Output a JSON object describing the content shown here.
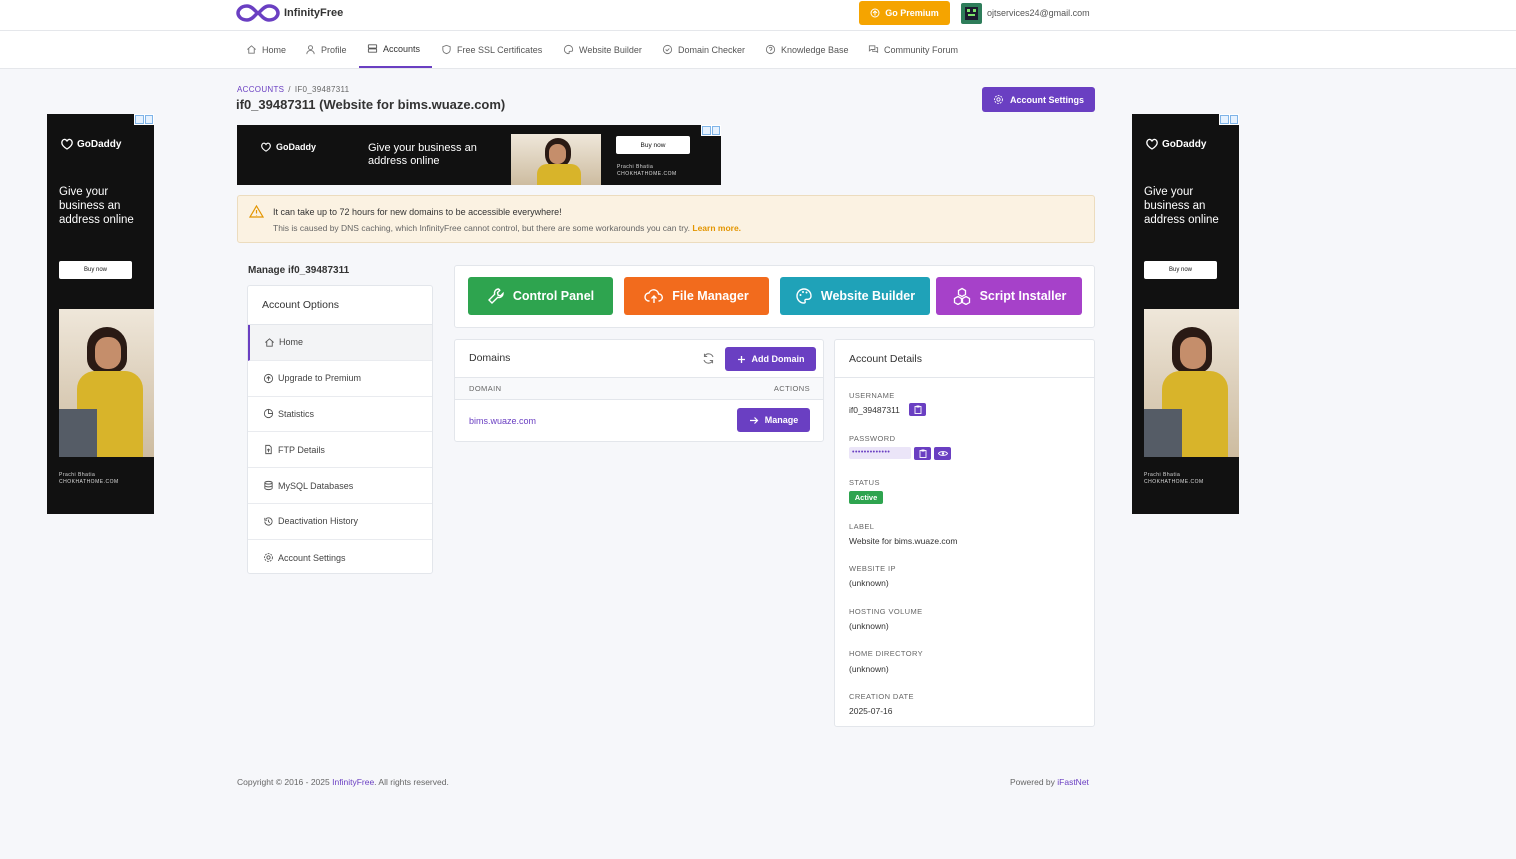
{
  "header": {
    "brand": "InfinityFree",
    "go_premium": "Go Premium",
    "user_email": "ojtservices24@gmail.com"
  },
  "nav": {
    "items": [
      {
        "label": "Home",
        "icon": "home-icon"
      },
      {
        "label": "Profile",
        "icon": "user-icon"
      },
      {
        "label": "Accounts",
        "icon": "server-icon",
        "active": true
      },
      {
        "label": "Free SSL Certificates",
        "icon": "shield-icon"
      },
      {
        "label": "Website Builder",
        "icon": "palette-icon"
      },
      {
        "label": "Domain Checker",
        "icon": "check-circle-icon"
      },
      {
        "label": "Knowledge Base",
        "icon": "help-circle-icon"
      },
      {
        "label": "Community Forum",
        "icon": "chat-icon"
      }
    ]
  },
  "breadcrumb": {
    "root": "ACCOUNTS",
    "sep": "/",
    "current": "IF0_39487311"
  },
  "page_title": "if0_39487311 (Website for bims.wuaze.com)",
  "account_settings_button": "Account Settings",
  "ads": {
    "side": {
      "brand": "GoDaddy",
      "headline": "Give your business an address online",
      "cta": "Buy now",
      "credit_name": "Prachi Bhatia",
      "credit_site": "CHOKHATHOME.COM"
    },
    "banner": {
      "brand": "GoDaddy",
      "headline": "Give your business an address online",
      "cta": "Buy now",
      "credit_name": "Prachi Bhatia",
      "credit_site": "CHOKHATHOME.COM"
    }
  },
  "alert": {
    "title": "It can take up to 72 hours for new domains to be accessible everywhere!",
    "body": "This is caused by DNS caching, which InfinityFree cannot control, but there are some workarounds you can try.",
    "link": "Learn more."
  },
  "manage_title": "Manage if0_39487311",
  "options": {
    "title": "Account Options",
    "items": [
      {
        "label": "Home",
        "icon": "home-icon",
        "active": true
      },
      {
        "label": "Upgrade to Premium",
        "icon": "arrow-up-circle-icon"
      },
      {
        "label": "Statistics",
        "icon": "pie-chart-icon"
      },
      {
        "label": "FTP Details",
        "icon": "file-upload-icon"
      },
      {
        "label": "MySQL Databases",
        "icon": "database-icon"
      },
      {
        "label": "Deactivation History",
        "icon": "history-icon"
      },
      {
        "label": "Account Settings",
        "icon": "gear-icon"
      }
    ]
  },
  "tools": [
    {
      "label": "Control Panel",
      "color": "#2ea44f",
      "icon": "wrench-icon"
    },
    {
      "label": "File Manager",
      "color": "#f26b1d",
      "icon": "cloud-upload-icon"
    },
    {
      "label": "Website Builder",
      "color": "#1fa2b8",
      "icon": "palette-icon"
    },
    {
      "label": "Script Installer",
      "color": "#a641c9",
      "icon": "boxes-icon"
    }
  ],
  "domains": {
    "title": "Domains",
    "add_button": "Add Domain",
    "col_domain": "DOMAIN",
    "col_actions": "ACTIONS",
    "rows": [
      {
        "domain": "bims.wuaze.com",
        "action": "Manage"
      }
    ]
  },
  "details": {
    "title": "Account Details",
    "username_label": "USERNAME",
    "username": "if0_39487311",
    "password_label": "PASSWORD",
    "password": "•••••••••••••",
    "status_label": "STATUS",
    "status": "Active",
    "label_label": "LABEL",
    "label": "Website for bims.wuaze.com",
    "ip_label": "WEBSITE IP",
    "ip": "(unknown)",
    "volume_label": "HOSTING VOLUME",
    "volume": "(unknown)",
    "homedir_label": "HOME DIRECTORY",
    "homedir": "(unknown)",
    "created_label": "CREATION DATE",
    "created": "2025-07-16"
  },
  "footer": {
    "copyright_prefix": "Copyright © 2016 - 2025",
    "brand": "InfinityFree",
    "copyright_suffix": ". All rights reserved.",
    "powered_prefix": "Powered by",
    "powered_link": "iFastNet"
  },
  "colors": {
    "accent": "#6a3fc2",
    "premium": "#f5a400",
    "success": "#2ea44f"
  }
}
